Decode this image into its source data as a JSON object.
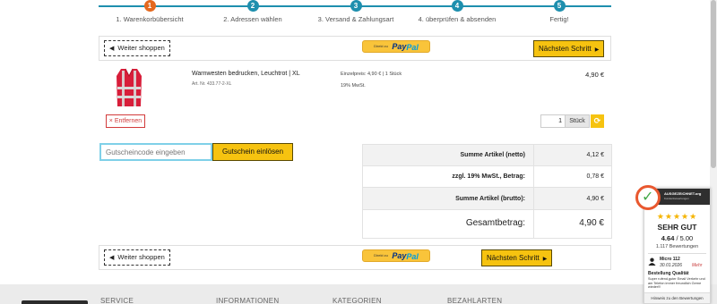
{
  "progress": {
    "steps": [
      {
        "num": "1",
        "label": "1. Warenkorbübersicht"
      },
      {
        "num": "2",
        "label": "2. Adressen wählen"
      },
      {
        "num": "3",
        "label": "3. Versand & Zahlungsart"
      },
      {
        "num": "4",
        "label": "4. überprüfen & absenden"
      },
      {
        "num": "5",
        "label": "Fertig!"
      }
    ],
    "active_step": 1
  },
  "top_bar": {
    "back_label": "Weiter shoppen",
    "paypal_small": "Direkt zu",
    "paypal_brand_1": "Pay",
    "paypal_brand_2": "Pal",
    "next_label": "Nächsten Schritt"
  },
  "cart_item": {
    "title": "Warnwesten bedrucken, Leuchtrot | XL",
    "article": "Art. Nr. 433.77-2-XL",
    "unit_price": "Einzelpreis: 4,90 € | 1 Stück",
    "vat": "19% MwSt.",
    "price": "4,90 €",
    "remove_label": "× Entfernen",
    "quantity": "1",
    "quantity_unit": "Stück"
  },
  "coupon": {
    "placeholder": "Gutscheincode eingeben",
    "button_label": "Gutschein einlösen"
  },
  "totals": {
    "rows": [
      {
        "label": "Summe Artikel (netto)",
        "value": "4,12 €"
      },
      {
        "label": "zzgl. 19% MwSt., Betrag:",
        "value": "0,78 €"
      },
      {
        "label": "Summe Artikel (brutto):",
        "value": "4,90 €"
      },
      {
        "label": "Gesamtbetrag:",
        "value": "4,90 €"
      }
    ]
  },
  "bottom_bar": {
    "back_label": "Weiter shoppen",
    "paypal_small": "Direkt zu",
    "paypal_brand_1": "Pay",
    "paypal_brand_2": "Pal",
    "next_label": "Nächsten Schritt"
  },
  "footer": {
    "headings": [
      "SERVICE",
      "INFORMATIONEN",
      "KATEGORIEN",
      "BEZAHLARTEN"
    ]
  },
  "trust_badge": {
    "header_1": "AUSGEZEICHNET.org",
    "header_2": "Kundenbewertungen",
    "stars": "★★★★★",
    "grade": "SEHR GUT",
    "score": "4.64",
    "score_max": " / 5.00",
    "count": "1.117 Bewertungen",
    "reviewer": "Micro 112",
    "review_date": "30.01.2026",
    "more": "Mehr",
    "review_title": "Bestellung Qualität",
    "review_text": "Super rufend,guter Email Verkehr und am Telefon immer freundlich Gerne wieder!!!",
    "footer": "Hinweis zu den Bewertungen"
  },
  "colors": {
    "step_blue": "#1e8fae",
    "step_active": "#e4691f",
    "cta_yellow": "#f6c310",
    "remove_red": "#d23b3b",
    "coupon_border": "#7fd0e8"
  }
}
